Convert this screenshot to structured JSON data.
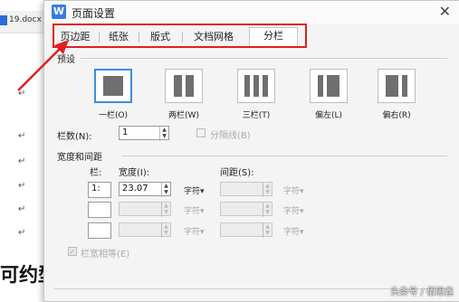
{
  "background_doc": {
    "tab_label": "19.docx",
    "paragraph_mark": "↵",
    "title_fragment": "可约型"
  },
  "dialog": {
    "app_icon": "wps-writer-icon",
    "title": "页面设置",
    "close_glyph": "✕"
  },
  "tabs": [
    "页边距",
    "纸张",
    "版式",
    "文档网格",
    "分栏"
  ],
  "active_tab": "分栏",
  "presets": {
    "section_label": "预设",
    "items": [
      {
        "label": "一栏(O)",
        "selected": true
      },
      {
        "label": "两栏(W)",
        "selected": false
      },
      {
        "label": "三栏(T)",
        "selected": false
      },
      {
        "label": "偏左(L)",
        "selected": false
      },
      {
        "label": "偏右(R)",
        "selected": false
      }
    ]
  },
  "columns": {
    "count_label": "栏数(N):",
    "count_value": "1",
    "divider_label": "分隔线(B)",
    "divider_checked": false
  },
  "width_spacing": {
    "section_label": "宽度和间距",
    "col_header": "栏:",
    "width_header": "宽度(I):",
    "spacing_header": "间距(S):",
    "unit": "字符",
    "rows": [
      {
        "index": "1:",
        "width": "23.07",
        "spacing": ""
      },
      {
        "index": "",
        "width": "",
        "spacing": ""
      },
      {
        "index": "",
        "width": "",
        "spacing": ""
      }
    ],
    "equal_width_label": "栏宽相等(E)",
    "equal_width_checked": true
  },
  "watermark": "头条号 / 佰思鑫",
  "colors": {
    "highlight": "#e02020",
    "accent": "#3b8ee0"
  }
}
